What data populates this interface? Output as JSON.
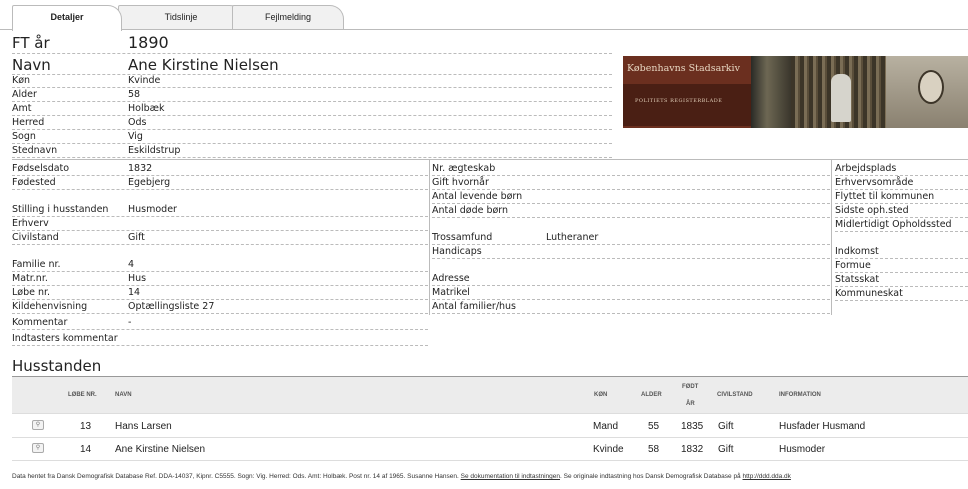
{
  "tabs": [
    {
      "label": "Detaljer",
      "active": true
    },
    {
      "label": "Tidslinje",
      "active": false
    },
    {
      "label": "Fejlmelding",
      "active": false
    }
  ],
  "header": {
    "ft_label": "FT år",
    "ft_value": "1890",
    "name_label": "Navn",
    "name_value": "Ane Kirstine Nielsen"
  },
  "banner": {
    "title": "Københavns Stadsarkiv",
    "subtitle": "POLITIETS REGISTERBLADE"
  },
  "person": [
    {
      "label": "Køn",
      "value": "Kvinde"
    },
    {
      "label": "Alder",
      "value": "58"
    },
    {
      "label": "Amt",
      "value": "Holbæk"
    },
    {
      "label": "Herred",
      "value": "Ods"
    },
    {
      "label": "Sogn",
      "value": "Vig"
    },
    {
      "label": "Stednavn",
      "value": "Eskildstrup"
    }
  ],
  "col1": [
    {
      "label": "Fødselsdato",
      "value": "1832"
    },
    {
      "label": "Fødested",
      "value": "Egebjerg"
    },
    {
      "label": "Stilling i husstanden",
      "value": "Husmoder"
    },
    {
      "label": "Erhverv",
      "value": ""
    },
    {
      "label": "Civilstand",
      "value": "Gift"
    },
    {
      "label": "Familie nr.",
      "value": "4"
    },
    {
      "label": "Matr.nr.",
      "value": "Hus"
    },
    {
      "label": "Løbe nr.",
      "value": "14"
    },
    {
      "label": "Kildehenvisning",
      "value": "Optællingsliste 27"
    },
    {
      "label": "Kommentar",
      "value": "-"
    },
    {
      "label": "Indtasters kommentar",
      "value": ""
    }
  ],
  "col2": [
    {
      "label": "Nr. ægteskab",
      "value": ""
    },
    {
      "label": "Gift hvornår",
      "value": ""
    },
    {
      "label": "Antal levende børn",
      "value": ""
    },
    {
      "label": "Antal døde børn",
      "value": ""
    },
    {
      "label": "Trossamfund",
      "value": "Lutheraner"
    },
    {
      "label": "Handicaps",
      "value": ""
    },
    {
      "label": "Adresse",
      "value": ""
    },
    {
      "label": "Matrikel",
      "value": ""
    },
    {
      "label": "Antal familier/hus",
      "value": ""
    }
  ],
  "col3": [
    {
      "label": "Arbejdsplads"
    },
    {
      "label": "Erhvervsområde"
    },
    {
      "label": "Flyttet til kommunen"
    },
    {
      "label": "Sidste oph.sted"
    },
    {
      "label": "Midlertidigt Opholdssted"
    },
    {
      "label": "Indkomst"
    },
    {
      "label": "Formue"
    },
    {
      "label": "Statsskat"
    },
    {
      "label": "Kommuneskat"
    }
  ],
  "household": {
    "title": "Husstanden",
    "columns": {
      "lobenr": "LØBE NR.",
      "navn": "NAVN",
      "kon": "KØN",
      "alder": "ALDER",
      "fodt1": "FØDT",
      "fodt2": "ÅR",
      "civil": "CIVILSTAND",
      "info": "INFORMATION"
    },
    "rows": [
      {
        "lobenr": "13",
        "navn": "Hans Larsen",
        "kon": "Mand",
        "alder": "55",
        "fodt": "1835",
        "civil": "Gift",
        "info": "Husfader Husmand"
      },
      {
        "lobenr": "14",
        "navn": "Ane Kirstine Nielsen",
        "kon": "Kvinde",
        "alder": "58",
        "fodt": "1832",
        "civil": "Gift",
        "info": "Husmoder"
      }
    ]
  },
  "footer": {
    "text1": "Data hentet fra Dansk Demografisk Database Ref. DDA-14037, Kipnr. C5555. Sogn: Vig. Herred: Ods. Amt: Holbæk. Post nr. 14 af 1965. Susanne Hansen.",
    "link1": "Se dokumentation til indtastningen",
    "text2": ". Se originale indtastning hos Dansk Demografisk Database på",
    "link2": "http://ddd.dda.dk"
  }
}
